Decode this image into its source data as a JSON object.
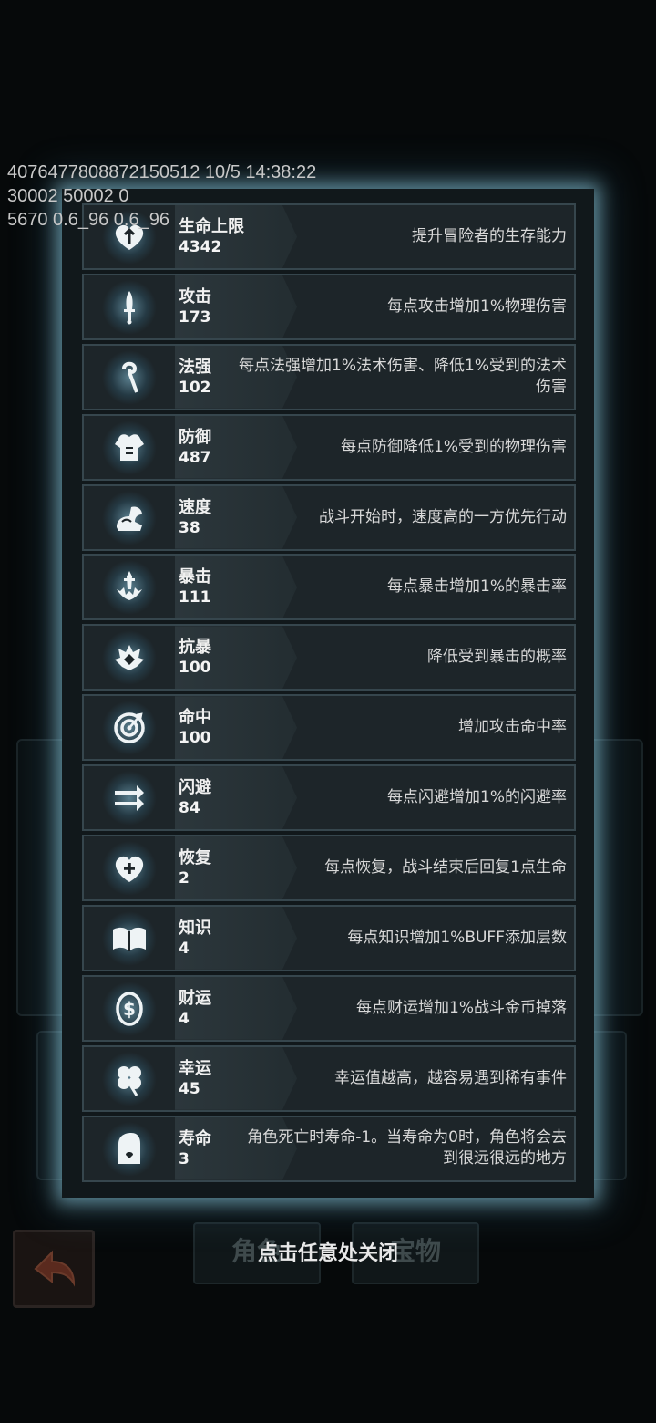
{
  "debug": {
    "line1": "40764778088721505​12 10/5 14:38:22",
    "line2": "30002 50002 0",
    "line3": "5670 0.6_96 0.6_96"
  },
  "stats": [
    {
      "name": "生命上限",
      "value": "4342",
      "desc": "提升冒险者的生存能力",
      "icon": "heart-arrow-icon"
    },
    {
      "name": "攻击",
      "value": "173",
      "desc": "每点攻击增加1%物理伤害",
      "icon": "sword-icon"
    },
    {
      "name": "法强",
      "value": "102",
      "desc": "每点法强增加1%法术伤害、降低1%受到的法术伤害",
      "icon": "staff-icon"
    },
    {
      "name": "防御",
      "value": "487",
      "desc": "每点防御降低1%受到的物理伤害",
      "icon": "armor-icon"
    },
    {
      "name": "速度",
      "value": "38",
      "desc": "战斗开始时，速度高的一方优先行动",
      "icon": "wing-boot-icon"
    },
    {
      "name": "暴击",
      "value": "111",
      "desc": "每点暴击增加1%的暴击率",
      "icon": "crit-sword-icon"
    },
    {
      "name": "抗暴",
      "value": "100",
      "desc": "降低受到暴击的概率",
      "icon": "shield-burst-icon"
    },
    {
      "name": "命中",
      "value": "100",
      "desc": "增加攻击命中率",
      "icon": "target-icon"
    },
    {
      "name": "闪避",
      "value": "84",
      "desc": "每点闪避增加1%的闪避率",
      "icon": "dodge-arrows-icon"
    },
    {
      "name": "恢复",
      "value": "2",
      "desc": "每点恢复，战斗结束后回复1点生命",
      "icon": "heart-plus-icon"
    },
    {
      "name": "知识",
      "value": "4",
      "desc": "每点知识增加1%BUFF添加层数",
      "icon": "book-icon"
    },
    {
      "name": "财运",
      "value": "4",
      "desc": "每点财运增加1%战斗金币掉落",
      "icon": "coin-icon"
    },
    {
      "name": "幸运",
      "value": "45",
      "desc": "幸运值越高，越容易遇到稀有事件",
      "icon": "clover-icon"
    },
    {
      "name": "寿命",
      "value": "3",
      "desc": "角色死亡时寿命-1。当寿命为0时，角色将会去到很远很远的地方",
      "icon": "tombstone-icon"
    }
  ],
  "close_hint": "点击任意处关闭",
  "bg_tabs": [
    "角色",
    "宝物"
  ]
}
